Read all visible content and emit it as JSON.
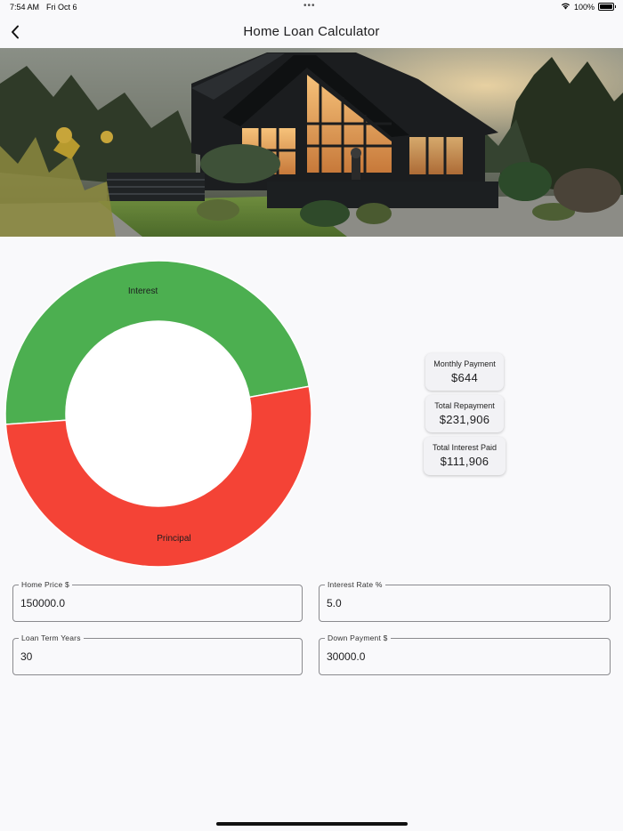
{
  "status_bar": {
    "time": "7:54 AM",
    "date": "Fri Oct 6",
    "dots": "•••",
    "battery": "100%",
    "icons": [
      "wifi-icon",
      "battery-icon"
    ]
  },
  "nav": {
    "title": "Home Loan Calculator",
    "back_icon": "chevron-left-icon"
  },
  "chart_data": {
    "type": "pie",
    "donut": true,
    "slices": [
      {
        "label": "Interest",
        "value": 111906,
        "color": "#4caf50"
      },
      {
        "label": "Principal",
        "value": 120000,
        "color": "#f44336"
      }
    ]
  },
  "summary": {
    "monthly_payment": {
      "label": "Monthly Payment",
      "value": "$644"
    },
    "total_repayment": {
      "label": "Total Repayment",
      "value": "$231,906"
    },
    "total_interest": {
      "label": "Total Interest Paid",
      "value": "$111,906"
    }
  },
  "form": {
    "home_price": {
      "label": "Home Price $",
      "value": "150000.0"
    },
    "interest_rate": {
      "label": "Interest Rate %",
      "value": "5.0"
    },
    "loan_term": {
      "label": "Loan Term Years",
      "value": "30"
    },
    "down_payment": {
      "label": "Down Payment $",
      "value": "30000.0"
    }
  },
  "colors": {
    "interest": "#4caf50",
    "principal": "#f44336",
    "background": "#f9f9fb"
  }
}
